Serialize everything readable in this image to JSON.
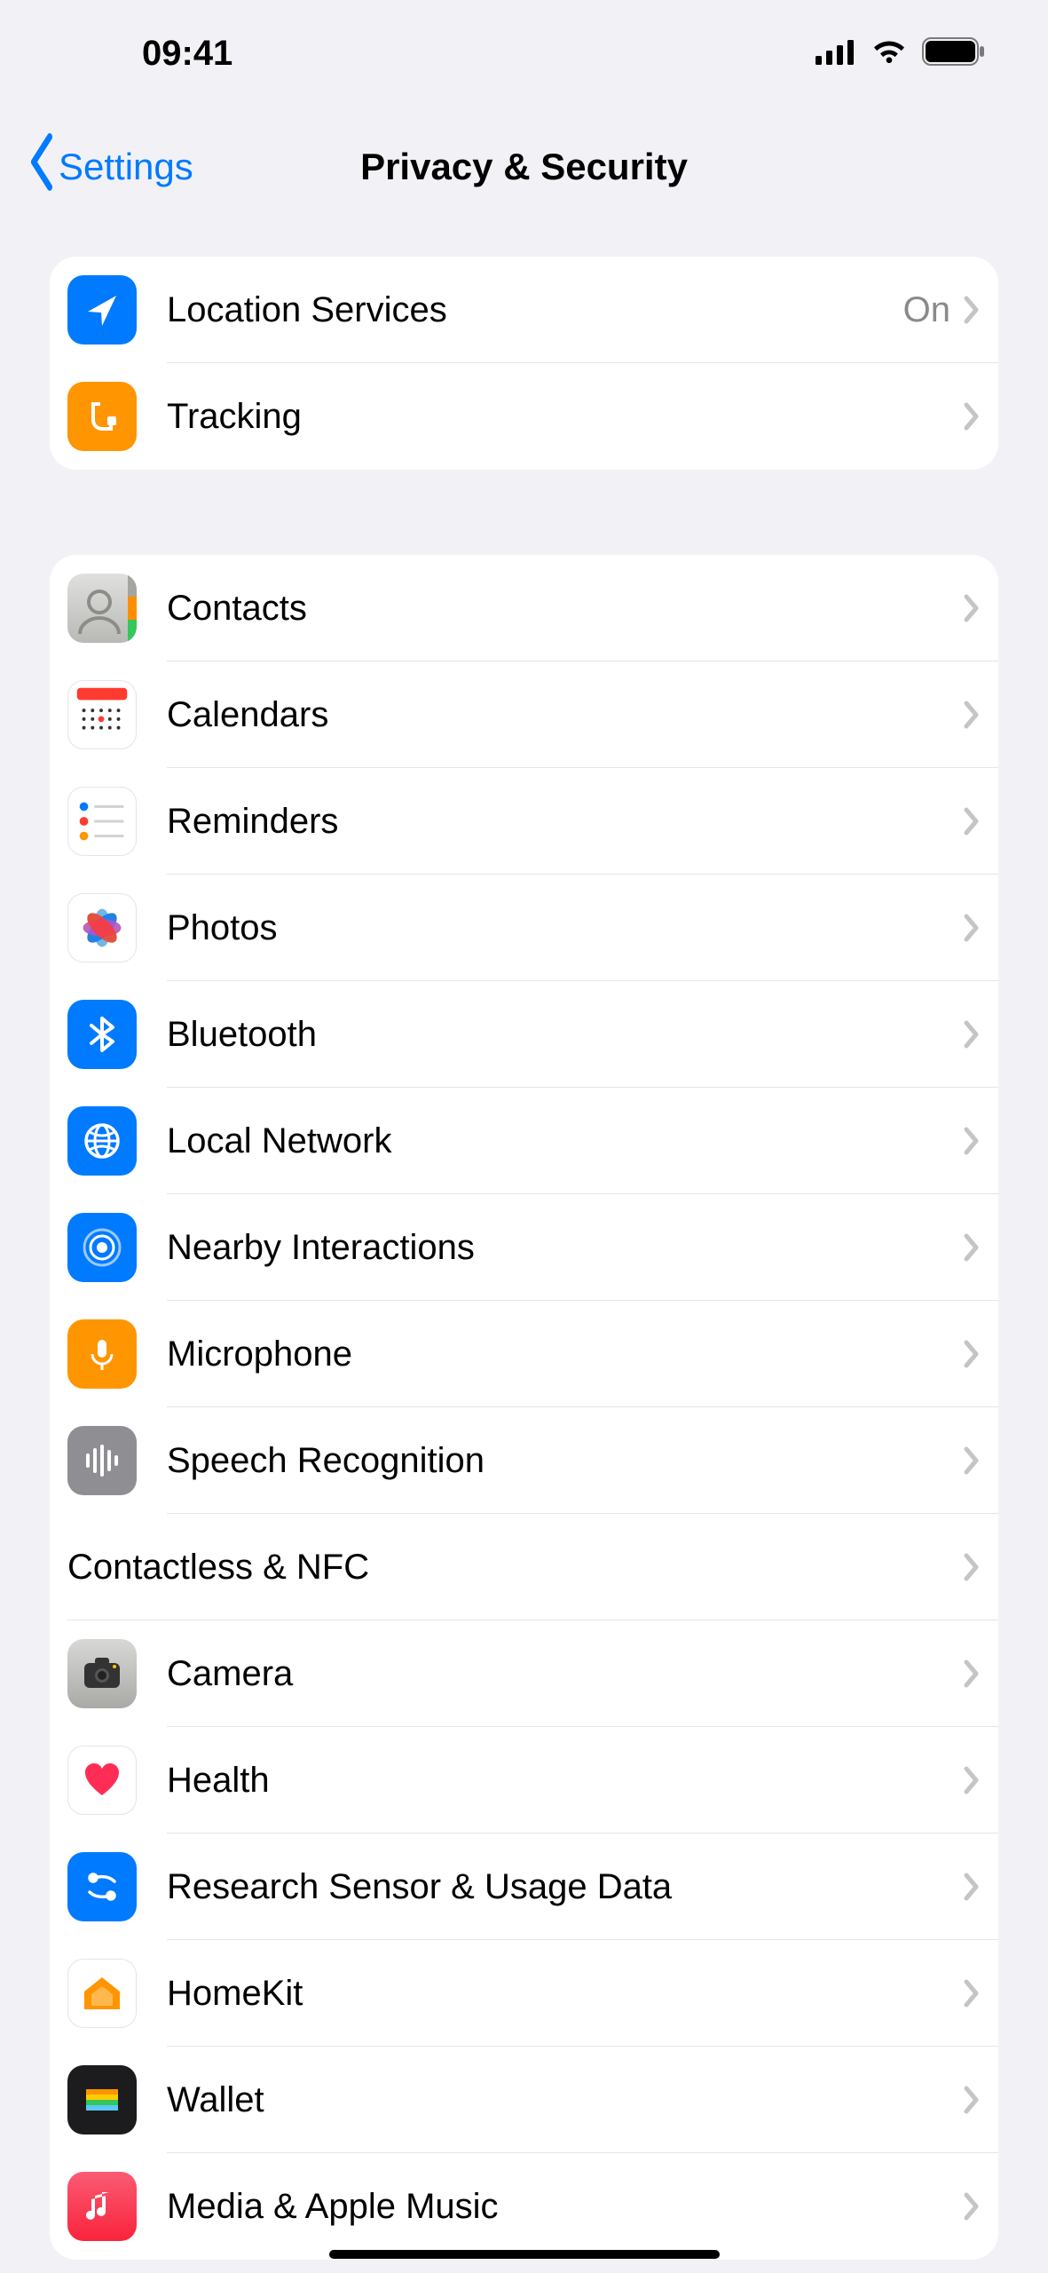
{
  "status": {
    "time": "09:41"
  },
  "nav": {
    "back": "Settings",
    "title": "Privacy & Security"
  },
  "group1": [
    {
      "label": "Location Services",
      "value": "On"
    },
    {
      "label": "Tracking"
    }
  ],
  "group2": [
    {
      "label": "Contacts"
    },
    {
      "label": "Calendars"
    },
    {
      "label": "Reminders"
    },
    {
      "label": "Photos"
    },
    {
      "label": "Bluetooth"
    },
    {
      "label": "Local Network"
    },
    {
      "label": "Nearby Interactions"
    },
    {
      "label": "Microphone"
    },
    {
      "label": "Speech Recognition"
    },
    {
      "label": "Contactless & NFC",
      "noicon": true
    },
    {
      "label": "Camera"
    },
    {
      "label": "Health"
    },
    {
      "label": "Research Sensor & Usage Data"
    },
    {
      "label": "HomeKit"
    },
    {
      "label": "Wallet"
    },
    {
      "label": "Media & Apple Music"
    }
  ]
}
